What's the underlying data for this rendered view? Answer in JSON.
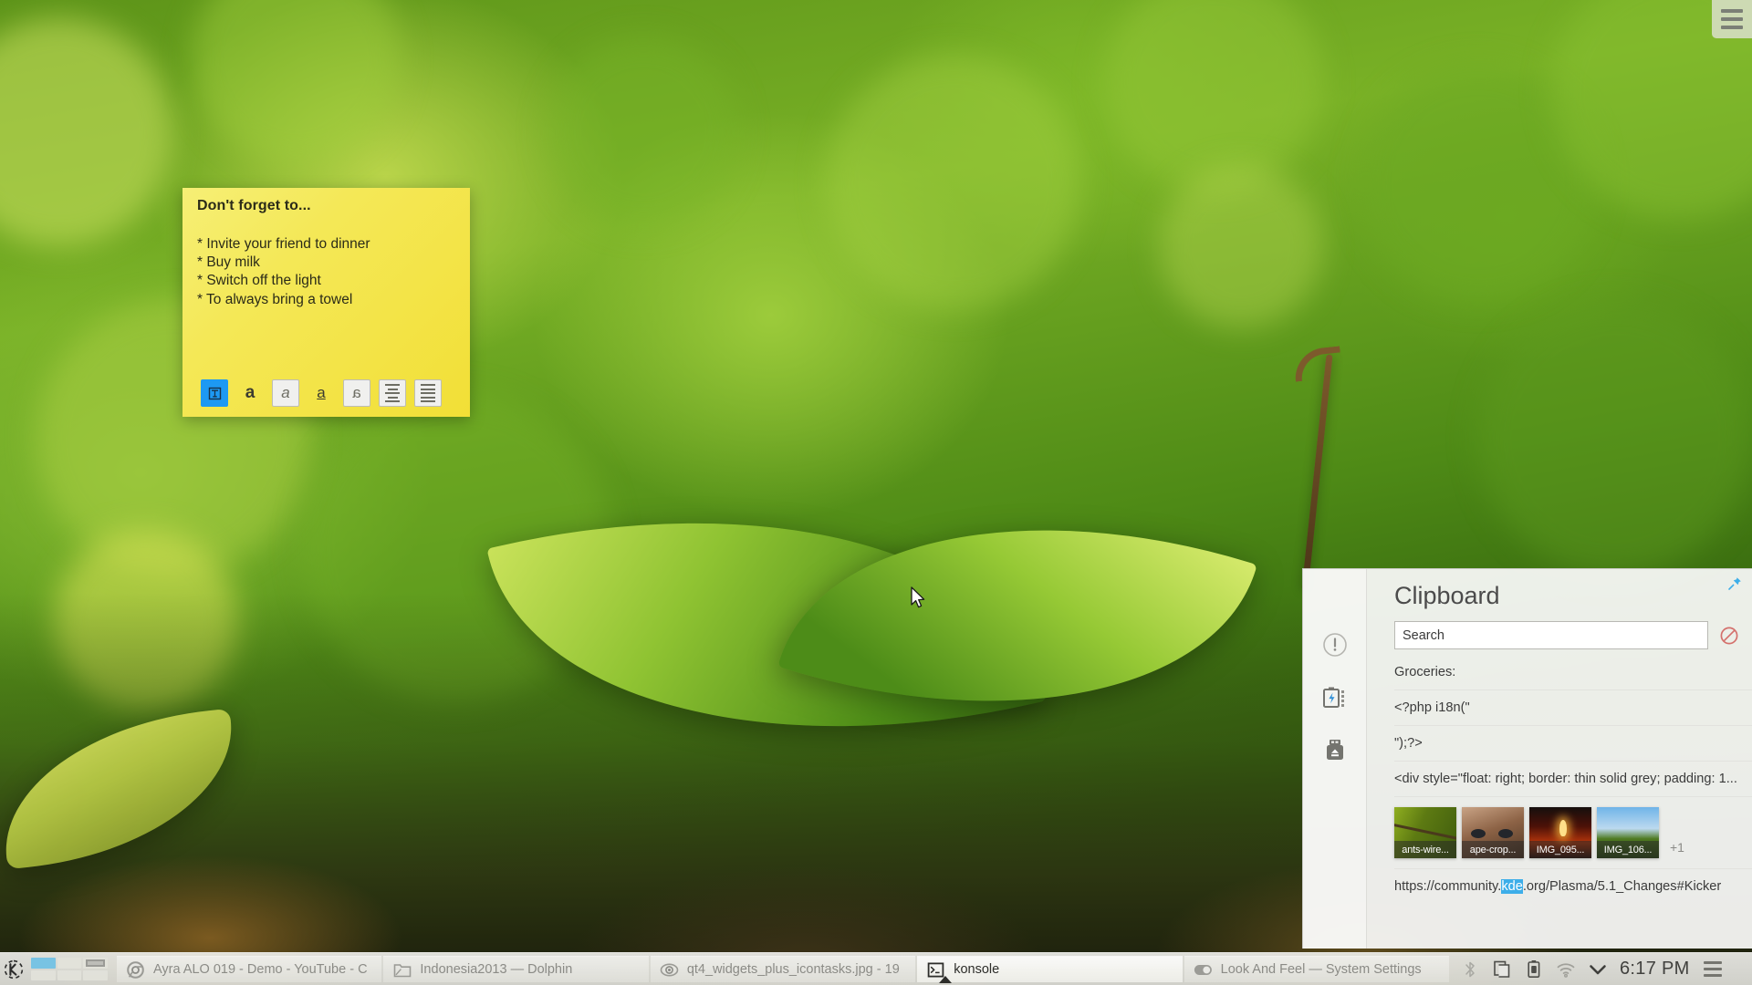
{
  "desktop": {
    "toolbox_label": "Desktop Toolbox",
    "wallpaper_description": "Green bokeh leaves"
  },
  "sticky_note": {
    "title": "Don't forget to...",
    "body": "* Invite your friend to dinner\n* Buy milk\n* Switch off the light\n* To always bring a towel",
    "toolbar": [
      {
        "name": "format-toggle",
        "glyph": "⌶",
        "state": "active"
      },
      {
        "name": "bold",
        "glyph": "a",
        "state": "plain"
      },
      {
        "name": "italic",
        "glyph": "a",
        "state": "framed"
      },
      {
        "name": "underline",
        "glyph": "a",
        "state": "plain"
      },
      {
        "name": "strikethrough",
        "glyph": "a",
        "state": "framed"
      },
      {
        "name": "align-center",
        "glyph": "",
        "state": "framed"
      },
      {
        "name": "align-justify",
        "glyph": "",
        "state": "framed"
      }
    ],
    "colors": {
      "paper_light": "#f6ef76",
      "paper_dark": "#f2df36",
      "accent": "#1d99f3"
    }
  },
  "clipboard": {
    "title": "Clipboard",
    "pin_label": "Pin",
    "clear_label": "Clear Clipboard History",
    "search": {
      "placeholder": "Search",
      "value": ""
    },
    "sidebar_icons": [
      {
        "name": "notifications-icon",
        "label": "Notifications"
      },
      {
        "name": "battery-icon",
        "label": "Battery and Brightness"
      },
      {
        "name": "removable-device-icon",
        "label": "Removable Devices"
      }
    ],
    "entries": [
      "Groceries:",
      "<?php i18n(\"",
      "\");?>",
      "<div style=\"float: right; border: thin solid grey; padding: 1..."
    ],
    "thumbnails": [
      {
        "caption": "ants-wire...",
        "class": "th-ants"
      },
      {
        "caption": "ape-crop...",
        "class": "th-ape"
      },
      {
        "caption": "IMG_095...",
        "class": "th-img095"
      },
      {
        "caption": "IMG_106...",
        "class": "th-img106"
      }
    ],
    "thumbnails_overflow": "+1",
    "url_entry": {
      "prefix": "https://community.",
      "highlight": "kde",
      "suffix": ".org/Plasma/5.1_Changes#Kicker"
    }
  },
  "panel": {
    "kickoff_label": "Application Launcher",
    "pager": {
      "label": "Pager",
      "cells": [
        {
          "current": true,
          "has_window": false
        },
        {
          "current": false,
          "has_window": false
        },
        {
          "current": false,
          "has_window": true
        },
        {
          "current": false,
          "has_window": false
        },
        {
          "current": false,
          "has_window": false
        },
        {
          "current": false,
          "has_window": false
        }
      ]
    },
    "tasks": [
      {
        "label": "Ayra ALO 019 - Demo - YouTube - C",
        "icon": "chrome-icon",
        "active": false
      },
      {
        "label": "Indonesia2013 — Dolphin",
        "icon": "folder-icon",
        "active": false
      },
      {
        "label": "qt4_widgets_plus_icontasks.jpg - 19",
        "icon": "gwenview-icon",
        "active": false
      },
      {
        "label": "konsole",
        "icon": "konsole-icon",
        "active": true
      },
      {
        "label": "Look And Feel — System Settings",
        "icon": "toggle-icon",
        "active": false
      }
    ],
    "tray": [
      {
        "name": "bluetooth-icon",
        "label": "Bluetooth"
      },
      {
        "name": "clipboard-icon",
        "label": "Clipboard"
      },
      {
        "name": "battery-icon",
        "label": "Battery"
      },
      {
        "name": "wifi-icon",
        "label": "Networks"
      },
      {
        "name": "chevron-down-icon",
        "label": "Show hidden icons"
      }
    ],
    "clock": "6:17 PM",
    "toolbox_label": "Panel Toolbox"
  }
}
